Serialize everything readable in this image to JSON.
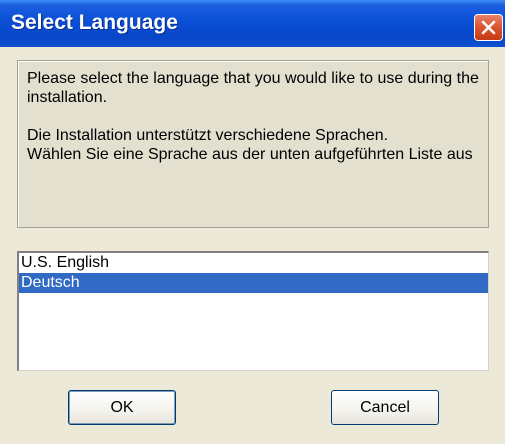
{
  "window": {
    "title": "Select Language"
  },
  "message": {
    "line1": "Please select the language that you would like to use during the installation.",
    "line2": "Die Installation unterstützt verschiedene Sprachen.",
    "line3": "Wählen Sie eine Sprache aus der unten aufgeführten Liste aus"
  },
  "languages": {
    "items": [
      {
        "label": "U.S. English",
        "selected": false
      },
      {
        "label": "Deutsch",
        "selected": true
      }
    ]
  },
  "buttons": {
    "ok_label": "OK",
    "cancel_label": "Cancel"
  },
  "colors": {
    "titlebar": "#0a4fd6",
    "selection": "#316ac5",
    "close_button": "#d9532c",
    "dialog_background": "#ece9d8"
  },
  "icons": {
    "close": "close-icon"
  }
}
